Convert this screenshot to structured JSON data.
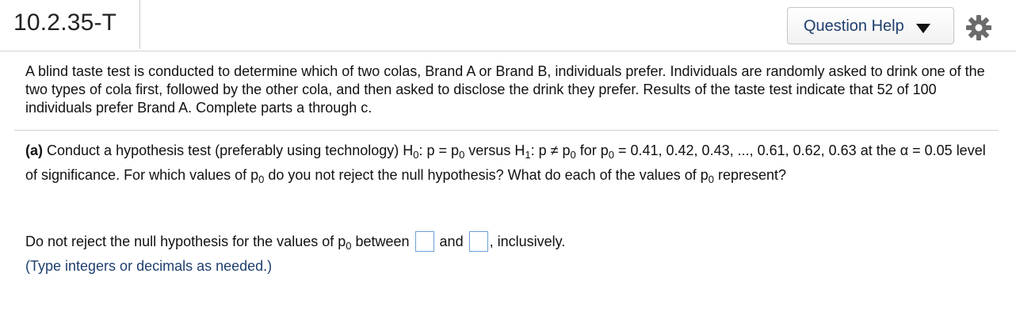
{
  "header": {
    "question_id": "10.2.35-T",
    "help_button_label": "Question Help",
    "help_caret_icon": "caret-down-icon",
    "settings_icon": "gear-icon"
  },
  "intro": {
    "text": "A blind taste test is conducted to determine which of two colas, Brand A or Brand B, individuals prefer. Individuals are randomly asked to drink one of the two types of cola first, followed by the other cola, and then asked to disclose the drink they prefer. Results of the taste test indicate that 52 of 100 individuals prefer Brand A. Complete parts a through c."
  },
  "part_a": {
    "label": "(a)",
    "lead": "Conduct a hypothesis test (preferably using technology) H",
    "h0_sub": "0",
    "h0_eq": ": p = p",
    "p0_sub_1": "0",
    "versus": " versus H",
    "h1_sub": "1",
    "h1_eq": ": p ≠ p",
    "p0_sub_2": "0",
    "for_text": " for p",
    "p0_sub_3": "0",
    "values": " = 0.41, 0.42, 0.43, ..., 0.61, 0.62, 0.63 at the α = 0.05 level of significance. For which values of p",
    "p0_sub_4": "0",
    "question": " do you not reject the null hypothesis? What do each of the values of p",
    "p0_sub_5": "0",
    "represent": " represent?"
  },
  "answer": {
    "lead": "Do not reject the null hypothesis for the values of p",
    "p0_sub": "0",
    "between": " between ",
    "and": " and ",
    "inclusively": ", inclusively.",
    "lower_value": "",
    "upper_value": ""
  },
  "note": "(Type integers or decimals as needed.)"
}
